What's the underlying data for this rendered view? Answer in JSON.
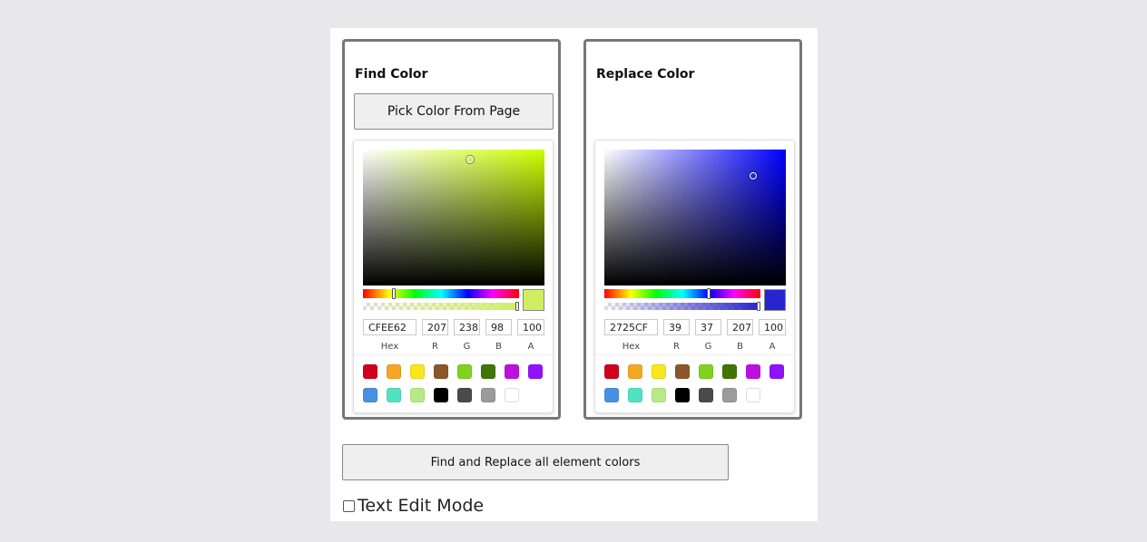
{
  "find": {
    "title": "Find Color",
    "pick_button": "Pick Color From Page",
    "hue_color": "#ccff00",
    "color": "#CFEE62",
    "hue_pos": 0.2,
    "alpha_pos": 1.0,
    "sv_pos": [
      0.59,
      0.07
    ],
    "fields": {
      "hex": "CFEE62",
      "r": "207",
      "g": "238",
      "b": "98",
      "a": "100"
    }
  },
  "replace": {
    "title": "Replace Color",
    "hue_color": "#0000ff",
    "color": "#2725CF",
    "hue_pos": 0.67,
    "alpha_pos": 1.0,
    "sv_pos": [
      0.82,
      0.19
    ],
    "fields": {
      "hex": "2725CF",
      "r": "39",
      "g": "37",
      "b": "207",
      "a": "100"
    }
  },
  "field_labels": {
    "hex": "Hex",
    "r": "R",
    "g": "G",
    "b": "B",
    "a": "A"
  },
  "presets_row1": [
    "#d0021b",
    "#f5a623",
    "#f8e71c",
    "#8b572a",
    "#7ed321",
    "#417505",
    "#bd10e0",
    "#9013fe"
  ],
  "presets_row2": [
    "#4a90e2",
    "#50e3c2",
    "#b8e986",
    "#000000",
    "#4a4a4a",
    "#9b9b9b",
    "#ffffff"
  ],
  "action_button": "Find and Replace all element colors",
  "text_edit_mode": {
    "label": "Text Edit Mode",
    "checked": false
  }
}
